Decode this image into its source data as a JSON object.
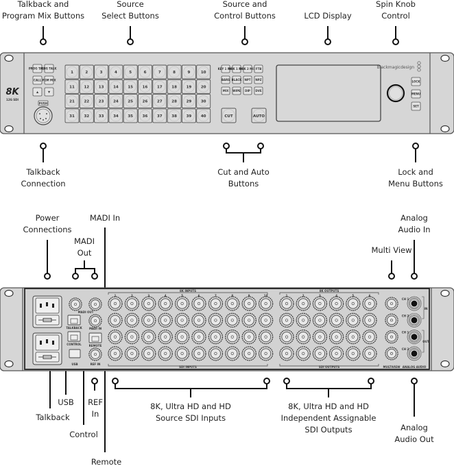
{
  "front_panel": {
    "callouts_top": [
      {
        "id": "talkback-program-mix",
        "lines": [
          "Talkback and",
          "Program Mix Buttons"
        ]
      },
      {
        "id": "source-select",
        "lines": [
          "Source",
          "Select Buttons"
        ]
      },
      {
        "id": "source-control",
        "lines": [
          "Source and",
          "Control  Buttons"
        ]
      },
      {
        "id": "lcd-display",
        "lines": [
          "LCD Display"
        ]
      },
      {
        "id": "spin-knob",
        "lines": [
          "Spin Knob",
          "Control"
        ]
      }
    ],
    "callouts_bottom": [
      {
        "id": "talkback-connection",
        "lines": [
          "Talkback",
          "Connection"
        ]
      },
      {
        "id": "cut-auto",
        "lines": [
          "Cut and Auto",
          "Buttons"
        ]
      },
      {
        "id": "lock-menu",
        "lines": [
          "Lock and",
          "Menu Buttons"
        ]
      }
    ],
    "logo": {
      "main": "8K",
      "sub": "12G SDI"
    },
    "brand": "Blackmagicdesign",
    "talkback_buttons": [
      "PROG TALK",
      "ENG TALK",
      "CALL",
      "PGM MIX",
      "▲",
      "▼"
    ],
    "xlr_label": "PUSH",
    "source_buttons": [
      "1",
      "2",
      "3",
      "4",
      "5",
      "6",
      "7",
      "8",
      "9",
      "10",
      "11",
      "12",
      "13",
      "14",
      "15",
      "16",
      "17",
      "18",
      "19",
      "20",
      "21",
      "22",
      "23",
      "24",
      "25",
      "26",
      "27",
      "28",
      "29",
      "30",
      "31",
      "32",
      "33",
      "34",
      "35",
      "36",
      "37",
      "38",
      "39",
      "40"
    ],
    "control_buttons": [
      "KEY 1 MIX",
      "DSK 1 MIX",
      "DSK 2 MIX",
      "FTB",
      "BARS",
      "BLACK",
      "NPT",
      "NPZ",
      "MIX",
      "WIPE",
      "DIP",
      "DVE"
    ],
    "transition_buttons": [
      "CUT",
      "AUTO"
    ],
    "side_buttons": [
      "LOCK",
      "MENU",
      "SET"
    ]
  },
  "rear_panel": {
    "callouts_top": [
      {
        "id": "power-connections",
        "lines": [
          "Power",
          "Connections"
        ]
      },
      {
        "id": "madi-in",
        "lines": [
          "MADI In"
        ]
      },
      {
        "id": "madi-out",
        "lines": [
          "MADI",
          "Out"
        ]
      },
      {
        "id": "multi-view",
        "lines": [
          "Multi View"
        ]
      },
      {
        "id": "analog-audio-in",
        "lines": [
          "Analog",
          "Audio In"
        ]
      }
    ],
    "callouts_bottom": [
      {
        "id": "usb",
        "lines": [
          "USB"
        ]
      },
      {
        "id": "talkback",
        "lines": [
          "Talkback"
        ]
      },
      {
        "id": "ref-in",
        "lines": [
          "REF",
          "In"
        ]
      },
      {
        "id": "control",
        "lines": [
          "Control"
        ]
      },
      {
        "id": "remote",
        "lines": [
          "Remote"
        ]
      },
      {
        "id": "sdi-inputs",
        "lines": [
          "8K, Ultra HD and HD",
          "Source SDI Inputs"
        ]
      },
      {
        "id": "sdi-outputs",
        "lines": [
          "8K, Ultra HD and HD",
          "Independent Assignable",
          "SDI Outputs"
        ]
      },
      {
        "id": "analog-audio-out",
        "lines": [
          "Analog",
          "Audio Out"
        ]
      }
    ],
    "port_labels": {
      "madi_out": "MADI OUT",
      "madi_in": "MADI IN",
      "talkback": "TALKBACK",
      "control": "CONTROL",
      "remote": "REMOTE",
      "usb": "USB",
      "ref_in": "REF IN",
      "inputs_top": "8K INPUTS",
      "inputs_bottom": "SDI INPUTS",
      "outputs_top": "8K OUTPUTS",
      "outputs_bottom": "SDI OUTPUTS",
      "multiview": "MULTIVIEW",
      "analog_audio": "ANALOG AUDIO",
      "audio_in": "IN",
      "audio_out": "OUT",
      "audio_channels": [
        "CH 1",
        "CH 2",
        "CH 1",
        "CH 2"
      ]
    },
    "input_column_numbers": [
      "1",
      "2",
      "3",
      "4",
      "5",
      "6",
      "7",
      "8",
      "9",
      "10"
    ],
    "output_column_numbers": [
      "1",
      "2",
      "3",
      "4",
      "5",
      "6"
    ],
    "multiview_numbers": [
      "1",
      "2",
      "3",
      "4"
    ],
    "madi_out_numbers": [
      "1",
      "2"
    ]
  }
}
